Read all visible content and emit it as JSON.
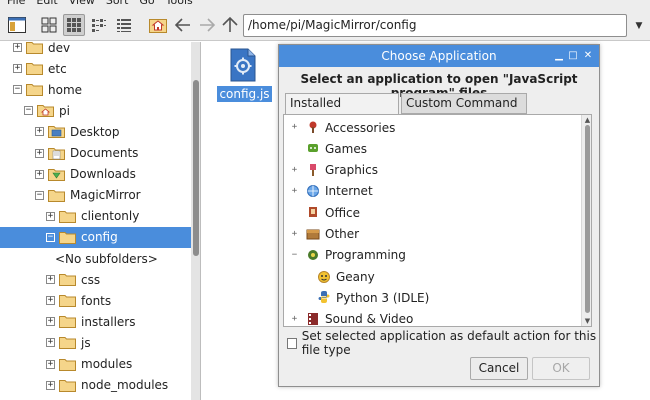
{
  "menubar": [
    "File",
    "Edit",
    "View",
    "Sort",
    "Go",
    "Tools"
  ],
  "address": {
    "path": "/home/pi/MagicMirror/config"
  },
  "tree": [
    {
      "label": "dev",
      "depth": 1,
      "expander": "+",
      "selected": false,
      "icon": "folder"
    },
    {
      "label": "etc",
      "depth": 1,
      "expander": "+",
      "selected": false,
      "icon": "folder"
    },
    {
      "label": "home",
      "depth": 1,
      "expander": "−",
      "selected": false,
      "icon": "folder"
    },
    {
      "label": "pi",
      "depth": 2,
      "expander": "−",
      "selected": false,
      "icon": "home-folder"
    },
    {
      "label": "Desktop",
      "depth": 3,
      "expander": "+",
      "selected": false,
      "icon": "desktop-folder"
    },
    {
      "label": "Documents",
      "depth": 3,
      "expander": "+",
      "selected": false,
      "icon": "documents-folder"
    },
    {
      "label": "Downloads",
      "depth": 3,
      "expander": "+",
      "selected": false,
      "icon": "downloads-folder"
    },
    {
      "label": "MagicMirror",
      "depth": 3,
      "expander": "−",
      "selected": false,
      "icon": "folder"
    },
    {
      "label": "clientonly",
      "depth": 4,
      "expander": "+",
      "selected": false,
      "icon": "folder"
    },
    {
      "label": "config",
      "depth": 4,
      "expander": "−",
      "selected": true,
      "icon": "folder"
    },
    {
      "label": "<No subfolders>",
      "depth": 5,
      "expander": "",
      "selected": false,
      "icon": ""
    },
    {
      "label": "css",
      "depth": 4,
      "expander": "+",
      "selected": false,
      "icon": "folder"
    },
    {
      "label": "fonts",
      "depth": 4,
      "expander": "+",
      "selected": false,
      "icon": "folder"
    },
    {
      "label": "installers",
      "depth": 4,
      "expander": "+",
      "selected": false,
      "icon": "folder"
    },
    {
      "label": "js",
      "depth": 4,
      "expander": "+",
      "selected": false,
      "icon": "folder"
    },
    {
      "label": "modules",
      "depth": 4,
      "expander": "+",
      "selected": false,
      "icon": "folder"
    },
    {
      "label": "node_modules",
      "depth": 4,
      "expander": "+",
      "selected": false,
      "icon": "folder"
    }
  ],
  "file": {
    "name": "config.js",
    "icon": "javascript-file-icon"
  },
  "dialog": {
    "title": "Choose Application",
    "prompt": "Select an application to open \"JavaScript program\" files",
    "tabs": [
      "Installed Applications",
      "Custom Command Line"
    ],
    "apps": [
      {
        "label": "Accessories",
        "expander": "+",
        "indent": false,
        "icon": "accessories-icon"
      },
      {
        "label": "Games",
        "expander": "",
        "indent": false,
        "icon": "games-icon"
      },
      {
        "label": "Graphics",
        "expander": "+",
        "indent": false,
        "icon": "graphics-icon"
      },
      {
        "label": "Internet",
        "expander": "+",
        "indent": false,
        "icon": "internet-icon"
      },
      {
        "label": "Office",
        "expander": "",
        "indent": false,
        "icon": "office-icon"
      },
      {
        "label": "Other",
        "expander": "+",
        "indent": false,
        "icon": "other-icon"
      },
      {
        "label": "Programming",
        "expander": "−",
        "indent": false,
        "icon": "programming-icon"
      },
      {
        "label": "Geany",
        "expander": "",
        "indent": true,
        "icon": "geany-icon"
      },
      {
        "label": "Python 3 (IDLE)",
        "expander": "",
        "indent": true,
        "icon": "python-icon"
      },
      {
        "label": "Sound & Video",
        "expander": "+",
        "indent": false,
        "icon": "sound-video-icon"
      }
    ],
    "checkbox_label": "Set selected application as default action for this file type",
    "cancel_label": "Cancel",
    "ok_label": "OK"
  },
  "colors": {
    "selection": "#4a8ddc",
    "folder": "#f5d58a"
  }
}
